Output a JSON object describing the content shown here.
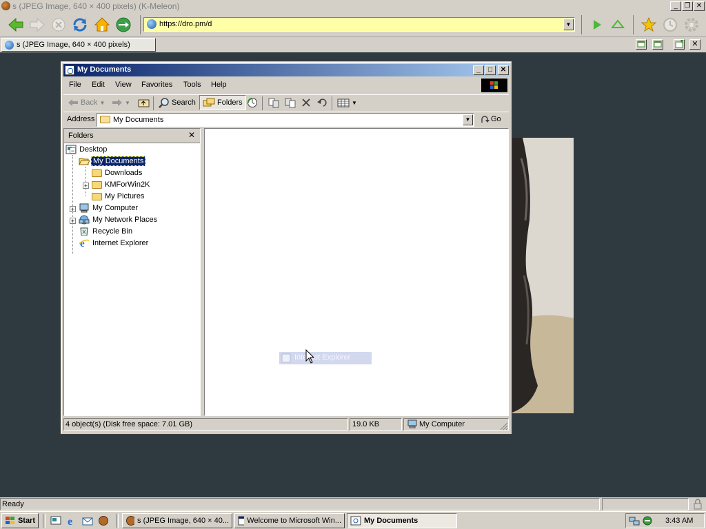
{
  "browser": {
    "title": "s (JPEG Image, 640 × 400 pixels) (K-Meleon)",
    "url": "https://dro.pm/d",
    "tab_label": "s (JPEG Image, 640 × 400 pixels)",
    "status": "Ready"
  },
  "explorer": {
    "title": "My Documents",
    "menu": [
      "File",
      "Edit",
      "View",
      "Favorites",
      "Tools",
      "Help"
    ],
    "toolbar": {
      "back": "Back",
      "search": "Search",
      "folders": "Folders"
    },
    "address_label": "Address",
    "address_value": "My Documents",
    "go_label": "Go",
    "folders_header": "Folders",
    "tree": [
      {
        "label": "Desktop",
        "level": 0,
        "icon": "desktop-icon"
      },
      {
        "label": "My Documents",
        "level": 1,
        "icon": "open-folder-icon",
        "selected": true,
        "expander": "−"
      },
      {
        "label": "Downloads",
        "level": 2,
        "icon": "folder-icon"
      },
      {
        "label": "KMForWin2K",
        "level": 2,
        "icon": "folder-icon",
        "expander": "+"
      },
      {
        "label": "My Pictures",
        "level": 2,
        "icon": "folder-icon"
      },
      {
        "label": "My Computer",
        "level": 1,
        "icon": "computer-icon",
        "expander": "+"
      },
      {
        "label": "My Network Places",
        "level": 1,
        "icon": "network-icon",
        "expander": "+"
      },
      {
        "label": "Recycle Bin",
        "level": 1,
        "icon": "recycle-bin-icon"
      },
      {
        "label": "Internet Explorer",
        "level": 1,
        "icon": "ie-icon"
      }
    ],
    "drag_ghost": "Internet Explorer",
    "status": {
      "objects": "4 object(s) (Disk free space: 7.01 GB)",
      "size": "19.0 KB",
      "zone": "My Computer"
    }
  },
  "taskbar": {
    "start": "Start",
    "tasks": [
      "s (JPEG Image, 640 × 40...",
      "Welcome to Microsoft Win...",
      "My Documents"
    ],
    "clock": "3:43 AM"
  },
  "colors": {
    "title_active_start": "#0a246a",
    "title_active_end": "#a6caf0",
    "selection": "#0a246a",
    "url_bar": "#ffffa8",
    "desktop": "#2f3a40"
  }
}
